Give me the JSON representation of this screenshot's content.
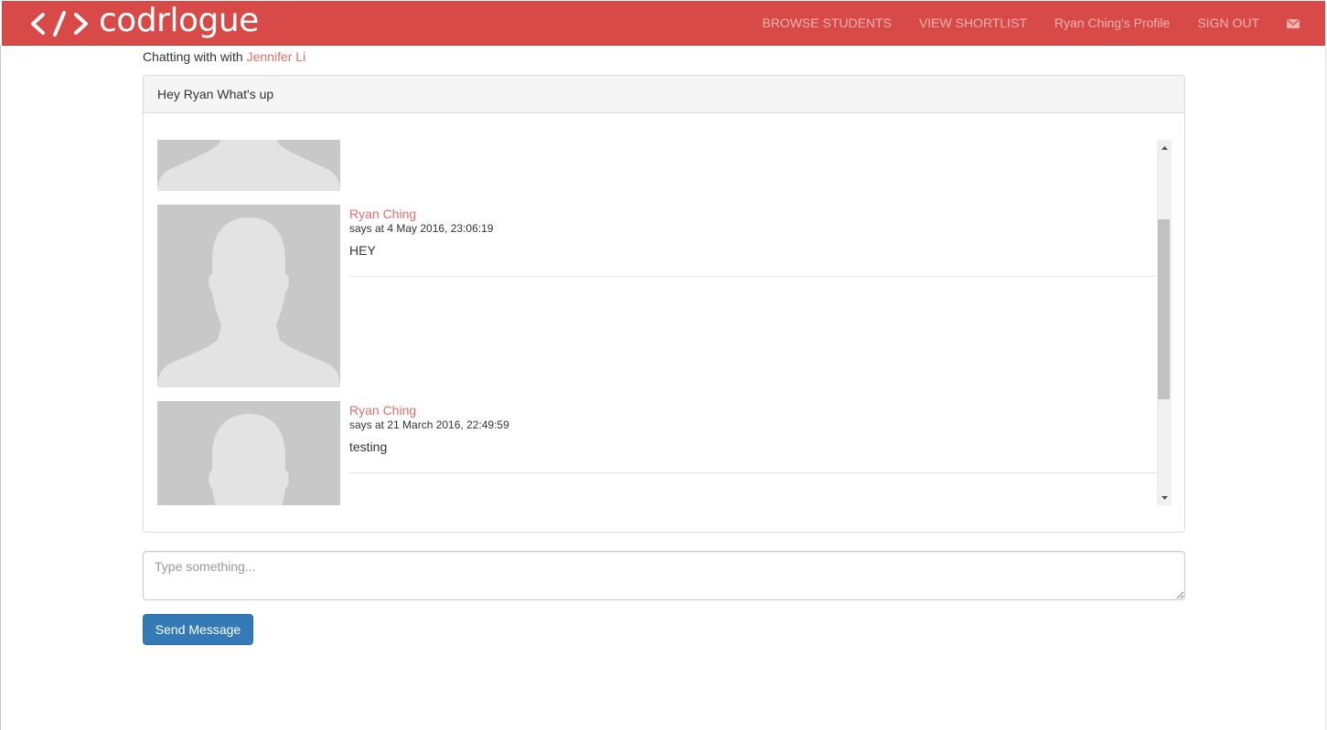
{
  "navbar": {
    "brand_name": "codrlogue",
    "brand_icon": "code-brackets-icon",
    "links": {
      "browse": "BROWSE STUDENTS",
      "shortlist": "VIEW SHORTLIST",
      "profile": "Ryan Ching's Profile",
      "signout": "SIGN OUT"
    },
    "mail_icon": "envelope-icon",
    "colors": {
      "background": "#d84a47",
      "link": "#f7b2b0"
    }
  },
  "chat": {
    "prefix": "Chatting with with",
    "partner": "Jennifer Li",
    "subject": "Hey Ryan What's up",
    "messages": [
      {
        "author": "Ryan Ching",
        "time": "says at 4 May 2016, 23:06:19",
        "text": "HEY"
      },
      {
        "author": "Ryan Ching",
        "time": "says at 21 March 2016, 22:49:59",
        "text": "testing"
      }
    ],
    "avatar_icon": "default-user-avatar",
    "accent_color": "#e3706c"
  },
  "composer": {
    "placeholder": "Type something...",
    "value": "",
    "send_label": "Send Message",
    "button_color": "#337ab7"
  }
}
